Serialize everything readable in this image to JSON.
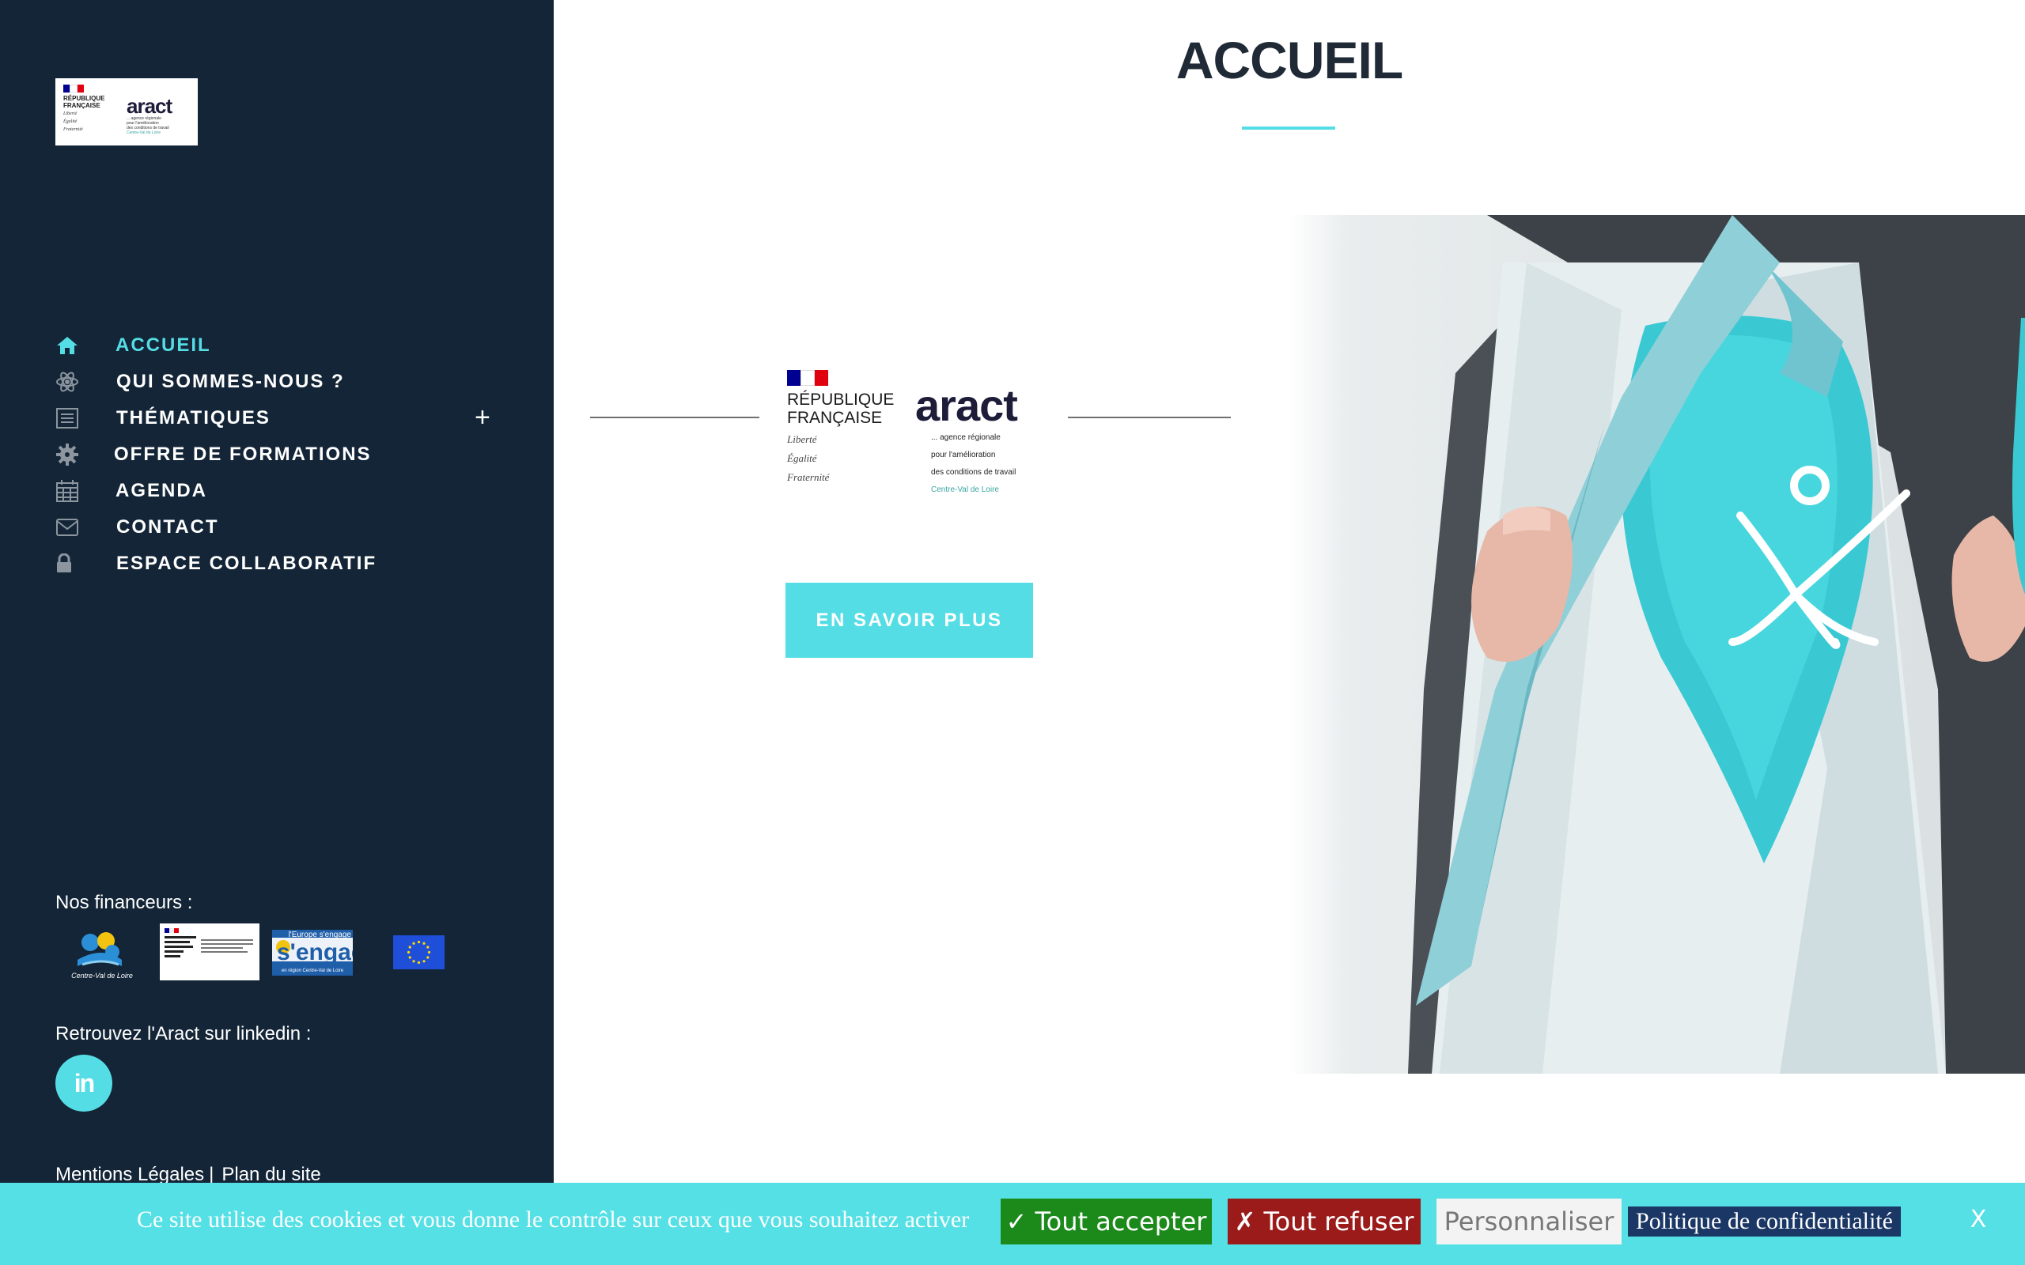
{
  "brand": {
    "marianne_lines": [
      "RÉPUBLIQUE",
      "FRANÇAISE"
    ],
    "motto_lines": [
      "Liberté",
      "Égalité",
      "Fraternité"
    ],
    "aract_word": "aract",
    "aract_tagline_lines": [
      "... agence régionale",
      "pour l'amélioration",
      "des conditions de travail"
    ],
    "aract_region": "Centre-Val de Loire",
    "flag_colors": [
      "#000091",
      "#ffffff",
      "#e1000f"
    ]
  },
  "nav": {
    "items": [
      {
        "label": "ACCUEIL",
        "icon": "home-icon",
        "active": true
      },
      {
        "label": "QUI SOMMES-NOUS ?",
        "icon": "atom-icon",
        "active": false
      },
      {
        "label": "THÉMATIQUES",
        "icon": "document-icon",
        "active": false,
        "expand": "+"
      },
      {
        "label": "OFFRE DE FORMATIONS",
        "icon": "gear-icon",
        "active": false
      },
      {
        "label": "AGENDA",
        "icon": "calendar-icon",
        "active": false
      },
      {
        "label": "CONTACT",
        "icon": "envelope-icon",
        "active": false
      },
      {
        "label": "ESPACE COLLABORATIF",
        "icon": "lock-icon",
        "active": false
      }
    ]
  },
  "funders": {
    "title": "Nos financeurs :",
    "centre_label": "Centre-Val de Loire",
    "europe_label": "l'Europe s'engage",
    "europe_sub": "en région Centre-Val de Loire"
  },
  "linkedin": {
    "title": "Retrouvez l'Aract sur linkedin :",
    "icon_text": "in"
  },
  "footer": {
    "legal": "Mentions Légales",
    "separator": "|",
    "sitemap": "Plan du site"
  },
  "main": {
    "title": "ACCUEIL",
    "cta_label": "EN SAVOIR PLUS"
  },
  "cookie": {
    "text": "Ce site utilise des cookies et vous donne le contrôle sur ceux que vous souhaitez activer",
    "accept": "✓ Tout accepter",
    "refuse": "✗ Tout refuser",
    "customize": "Personnaliser",
    "policy": "Politique de confidentialité",
    "close": "X"
  },
  "colors": {
    "sidebar_bg": "#132537",
    "accent": "#55dde5",
    "accept_bg": "#1b8a1b",
    "refuse_bg": "#9b1b1b",
    "policy_bg": "#1a3766"
  }
}
